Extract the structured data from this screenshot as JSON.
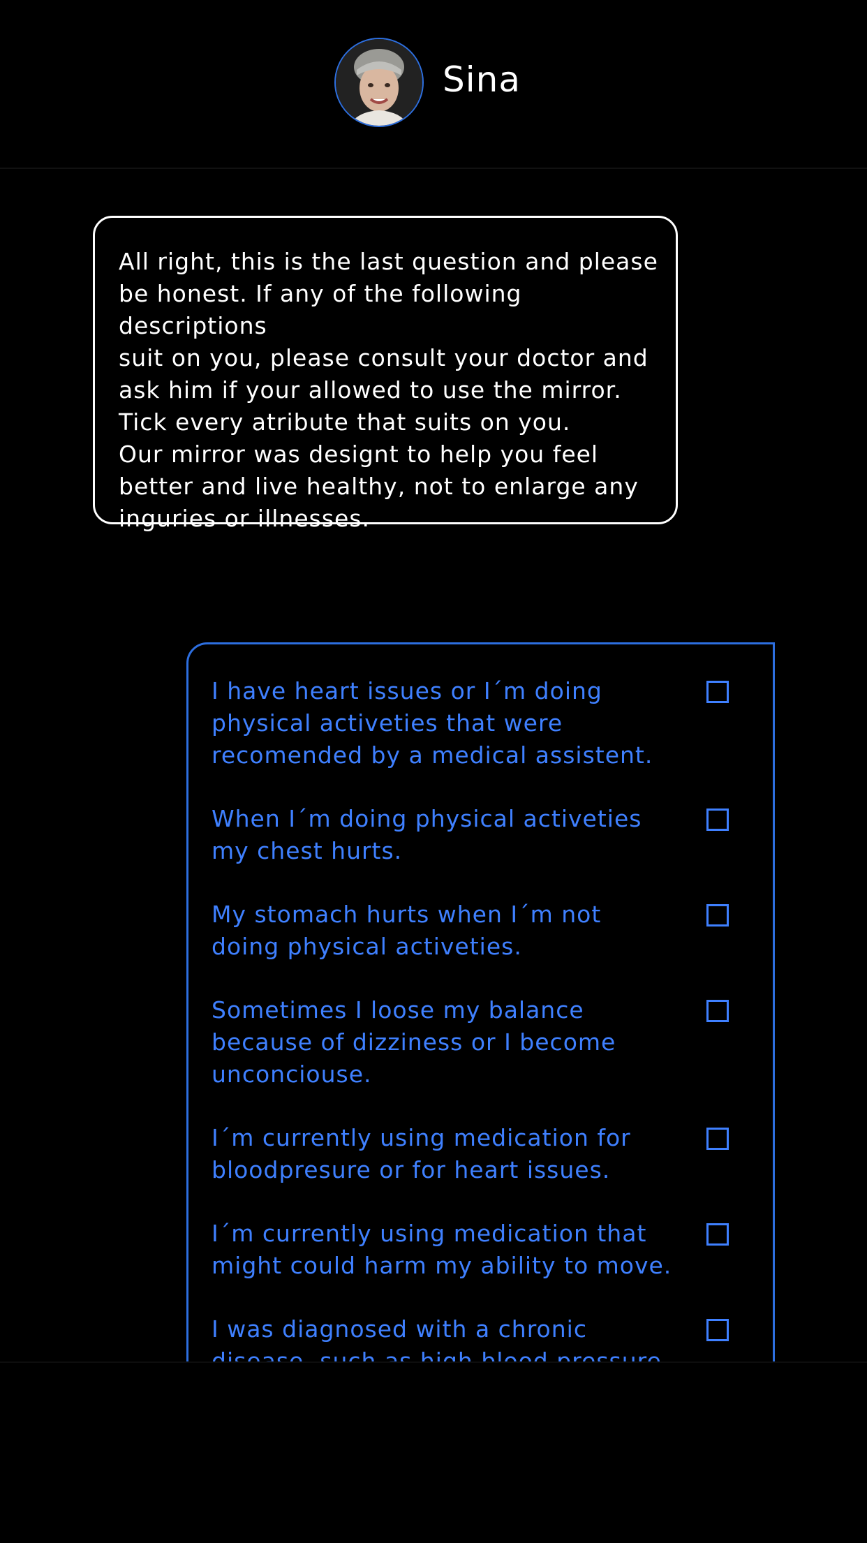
{
  "header": {
    "user_name": "Sina",
    "avatar_icon": "user-avatar-photo"
  },
  "message": {
    "text": "All right, this is the last question and please\nbe honest. If any of the following descriptions\nsuit on you, please consult your doctor and\nask him if your allowed to use the mirror.\nTick every atribute that suits on you.\nOur mirror was designt to help you feel\nbetter and live healthy, not to enlarge any\ninguries or illnesses."
  },
  "checklist": {
    "items": [
      {
        "label": "I have heart issues or I´m doing\nphysical activeties that were\nrecomended by a medical assistent.",
        "checked": false
      },
      {
        "label": "When I´m doing physical activeties\n my chest hurts.",
        "checked": false
      },
      {
        "label": "My stomach hurts when I´m not\ndoing physical activeties.",
        "checked": false
      },
      {
        "label": "Sometimes I loose my balance\nbecause of dizziness or I become\nunconciouse.",
        "checked": false
      },
      {
        "label": "I´m currently using medication for\nbloodpresure or for heart issues.",
        "checked": false
      },
      {
        "label": "I´m currently using medication that\nmight could harm my ability to move.",
        "checked": false
      },
      {
        "label": "I was diagnosed with a chronic\n disease, such as high blood pressure",
        "checked": false
      }
    ]
  },
  "colors": {
    "accent": "#3f80ff",
    "background": "#000000",
    "text": "#ffffff"
  }
}
